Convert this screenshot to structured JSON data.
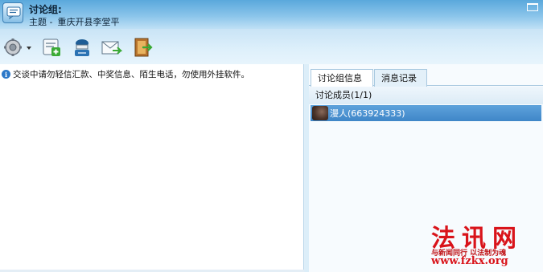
{
  "window": {
    "title": "讨论组:",
    "topic_label": "主题 -",
    "topic_value": "重庆开县李堂平"
  },
  "toolbar": {
    "buttons": [
      {
        "name": "settings-gear-icon"
      },
      {
        "name": "add-contact-icon"
      },
      {
        "name": "remote-assist-icon"
      },
      {
        "name": "email-icon"
      },
      {
        "name": "exit-door-icon"
      }
    ]
  },
  "chat": {
    "notice": "交谈中请勿轻信汇款、中奖信息、陌生电话，勿使用外挂软件。"
  },
  "side_panel": {
    "tabs": [
      {
        "label": "讨论组信息",
        "active": true
      },
      {
        "label": "消息记录",
        "active": false
      }
    ],
    "members_header": "讨论成员(1/1)",
    "members": [
      {
        "name": "漫人(663924333)",
        "selected": true
      }
    ]
  },
  "watermark": {
    "title": "法讯网",
    "slogan": "与新闻同行 以法制为魂",
    "url": "www.fzkx.org"
  },
  "colors": {
    "title_gradient_top": "#5aa8dc",
    "selection": "#3f86c8",
    "watermark_red": "#d9131a"
  }
}
